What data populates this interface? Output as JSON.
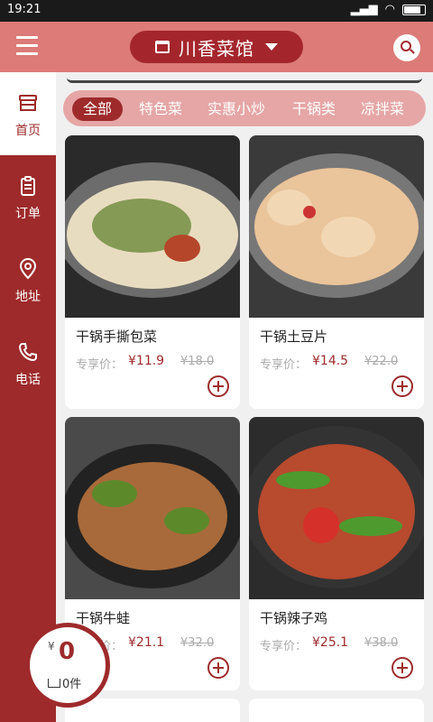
{
  "status_bar": {
    "time": "19:21"
  },
  "header": {
    "store_name": "川香菜馆"
  },
  "sidebar": {
    "items": [
      {
        "label": "首页",
        "icon": "store-icon",
        "active": true
      },
      {
        "label": "订单",
        "icon": "clipboard-icon",
        "active": false
      },
      {
        "label": "地址",
        "icon": "location-pin-icon",
        "active": false
      },
      {
        "label": "电话",
        "icon": "phone-icon",
        "active": false
      }
    ]
  },
  "categories": [
    {
      "label": "全部",
      "active": true
    },
    {
      "label": "特色菜",
      "active": false
    },
    {
      "label": "实惠小炒",
      "active": false
    },
    {
      "label": "干锅类",
      "active": false
    },
    {
      "label": "凉拌菜",
      "active": false
    }
  ],
  "products": [
    {
      "name": "干锅手撕包菜",
      "price_label": "专享价：",
      "price": "¥11.9",
      "old_price": "¥18.0"
    },
    {
      "name": "干锅土豆片",
      "price_label": "专享价：",
      "price": "¥14.5",
      "old_price": "¥22.0"
    },
    {
      "name": "干锅牛蛙",
      "price_label": "专享价：",
      "price": "¥21.1",
      "old_price": "¥32.0"
    },
    {
      "name": "干锅辣子鸡",
      "price_label": "专享价：",
      "price": "¥25.1",
      "old_price": "¥38.0"
    }
  ],
  "cart": {
    "currency": "¥",
    "total": "0",
    "count": "0件"
  },
  "colors": {
    "brand": "#9e2a2b",
    "header": "#dc7b78",
    "category_bar": "#e5a6a5"
  }
}
